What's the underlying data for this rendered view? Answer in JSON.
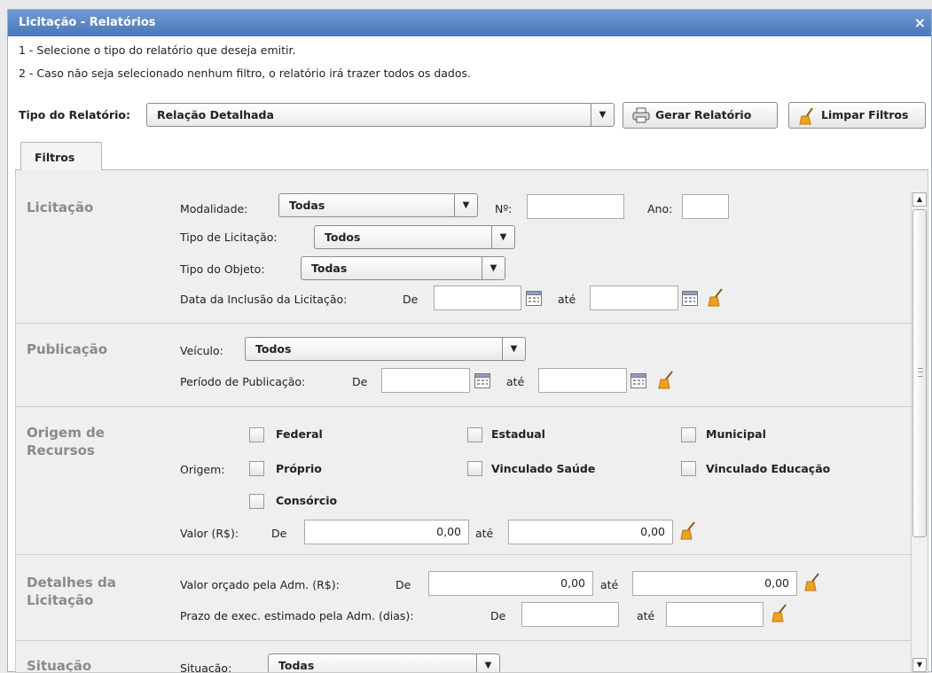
{
  "window": {
    "title": "Licitação - Relatórios",
    "close_label": "×"
  },
  "instructions": [
    "1 - Selecione o tipo do relatório que deseja emitir.",
    "2 - Caso não seja selecionado nenhum filtro, o relatório irá trazer todos os dados."
  ],
  "report_type": {
    "label": "Tipo do Relatório:",
    "value": "Relação Detalhada"
  },
  "buttons": {
    "generate": "Gerar Relatório",
    "clear": "Limpar Filtros"
  },
  "tabs": [
    "Filtros"
  ],
  "licitacao": {
    "title": "Licitação",
    "modalidade_label": "Modalidade:",
    "modalidade_value": "Todas",
    "numero_label": "Nº:",
    "ano_label": "Ano:",
    "tipo_licitacao_label": "Tipo de Licitação:",
    "tipo_licitacao_value": "Todos",
    "tipo_objeto_label": "Tipo do Objeto:",
    "tipo_objeto_value": "Todas",
    "data_inclusao_label": "Data da Inclusão da Licitação:",
    "de_label": "De",
    "ate_label": "até"
  },
  "publicacao": {
    "title": "Publicação",
    "veiculo_label": "Veículo:",
    "veiculo_value": "Todos",
    "periodo_label": "Período de Publicação:",
    "de_label": "De",
    "ate_label": "até"
  },
  "origem": {
    "title_line1": "Origem de",
    "title_line2": "Recursos",
    "origem_label": "Origem:",
    "options": [
      "Federal",
      "Estadual",
      "Municipal",
      "Próprio",
      "Vinculado Saúde",
      "Vinculado Educação",
      "Consórcio"
    ],
    "valor_label": "Valor (R$):",
    "de_label": "De",
    "ate_label": "até",
    "valor_de": "0,00",
    "valor_ate": "0,00"
  },
  "detalhes": {
    "title_line1": "Detalhes da",
    "title_line2": "Licitação",
    "valor_orcado_label": "Valor orçado pela Adm. (R$):",
    "de_label": "De",
    "ate_label": "até",
    "valor_de": "0,00",
    "valor_ate": "0,00",
    "prazo_label": "Prazo de exec. estimado pela Adm. (dias):",
    "prazo_de_label": "De",
    "prazo_ate_label": "até"
  },
  "situacao": {
    "title": "Situação",
    "label": "Situação:",
    "value": "Todas"
  },
  "colors": {
    "title_bar": "#5b87c6",
    "section_title": "#8a8a8a",
    "panel_bg": "#efefef",
    "broom_icon": "#f0a21c"
  }
}
